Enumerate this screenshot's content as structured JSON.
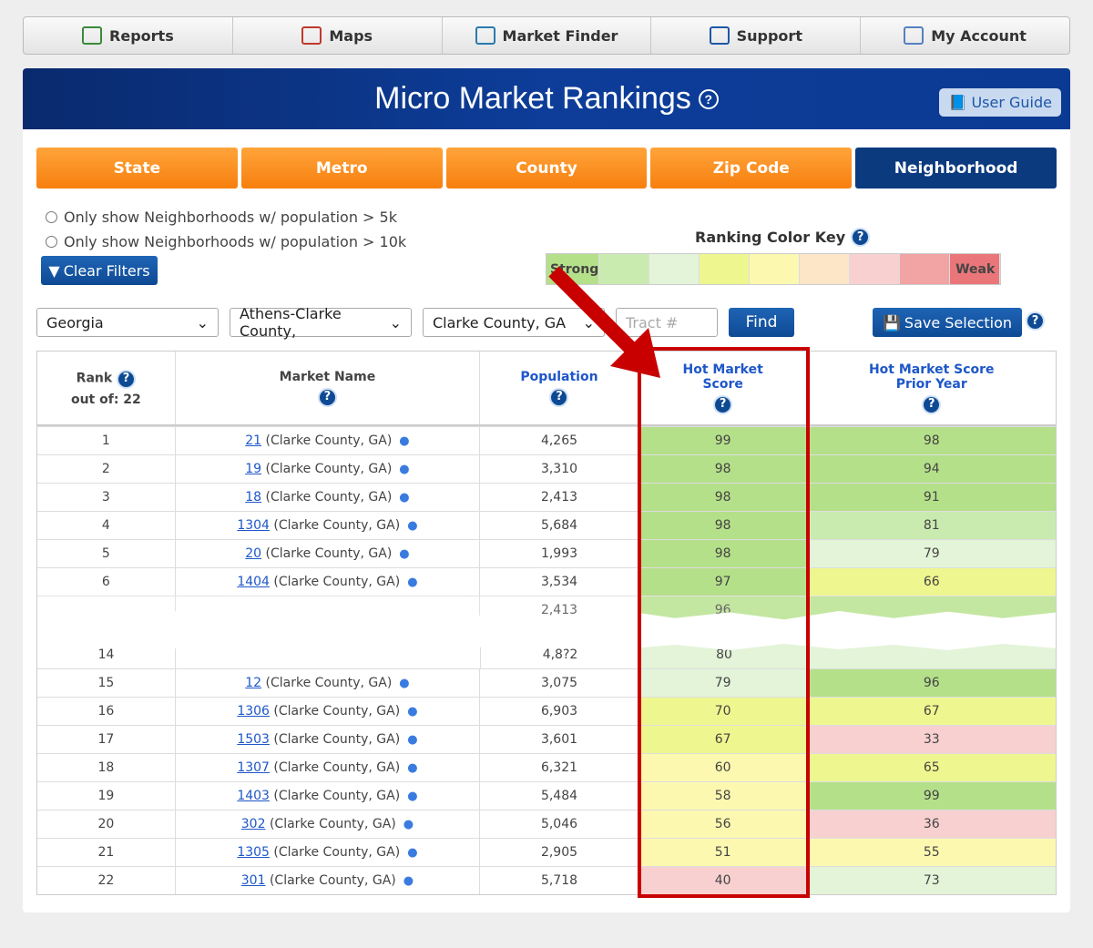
{
  "nav": [
    {
      "label": "Reports",
      "icon": "reports-icon"
    },
    {
      "label": "Maps",
      "icon": "maps-icon"
    },
    {
      "label": "Market Finder",
      "icon": "market-finder-icon"
    },
    {
      "label": "Support",
      "icon": "phone-icon"
    },
    {
      "label": "My Account",
      "icon": "account-icon"
    }
  ],
  "header": {
    "title": "Micro Market Rankings",
    "user_guide": "User Guide"
  },
  "tabs": [
    "State",
    "Metro",
    "County",
    "Zip Code",
    "Neighborhood"
  ],
  "active_tab": "Neighborhood",
  "filters": {
    "opt1": "Only show Neighborhoods w/ population > 5k",
    "opt2": "Only show Neighborhoods w/ population > 10k",
    "clear": "Clear Filters"
  },
  "color_key": {
    "title": "Ranking Color Key",
    "strong": "Strong",
    "weak": "Weak",
    "colors": [
      "#b5e08a",
      "#c9ebb0",
      "#e3f4d9",
      "#eef78f",
      "#fdf8b0",
      "#fde5c8",
      "#f8d0d0",
      "#f2a3a3",
      "#ea767a"
    ]
  },
  "selectors": {
    "state": "Georgia",
    "metro": "Athens-Clarke County,",
    "county": "Clarke County, GA",
    "tract_placeholder": "Tract #",
    "find": "Find",
    "save": "Save Selection"
  },
  "table": {
    "headers": {
      "rank": "Rank",
      "rank_sub": "out of: 22",
      "name": "Market Name",
      "population": "Population",
      "hot1": "Hot Market",
      "hot2": "Score",
      "prior1": "Hot Market Score",
      "prior2": "Prior Year"
    },
    "rows_top": [
      {
        "rank": "1",
        "tract": "21",
        "county": "(Clarke County, GA)",
        "pop": "4,265",
        "score": "99",
        "prior": "98"
      },
      {
        "rank": "2",
        "tract": "19",
        "county": "(Clarke County, GA)",
        "pop": "3,310",
        "score": "98",
        "prior": "94"
      },
      {
        "rank": "3",
        "tract": "18",
        "county": "(Clarke County, GA)",
        "pop": "2,413",
        "score": "98",
        "prior": "91"
      },
      {
        "rank": "4",
        "tract": "1304",
        "county": "(Clarke County, GA)",
        "pop": "5,684",
        "score": "98",
        "prior": "81"
      },
      {
        "rank": "5",
        "tract": "20",
        "county": "(Clarke County, GA)",
        "pop": "1,993",
        "score": "98",
        "prior": "79"
      },
      {
        "rank": "6",
        "tract": "1404",
        "county": "(Clarke County, GA)",
        "pop": "3,534",
        "score": "97",
        "prior": "66"
      }
    ],
    "torn": {
      "row7_pop": "2,413",
      "row7_score": "96",
      "row14_rank": "14",
      "row14_pop": "4,8?2",
      "row14_score": "80"
    },
    "rows_bottom": [
      {
        "rank": "15",
        "tract": "12",
        "county": "(Clarke County, GA)",
        "pop": "3,075",
        "score": "79",
        "prior": "96"
      },
      {
        "rank": "16",
        "tract": "1306",
        "county": "(Clarke County, GA)",
        "pop": "6,903",
        "score": "70",
        "prior": "67"
      },
      {
        "rank": "17",
        "tract": "1503",
        "county": "(Clarke County, GA)",
        "pop": "3,601",
        "score": "67",
        "prior": "33"
      },
      {
        "rank": "18",
        "tract": "1307",
        "county": "(Clarke County, GA)",
        "pop": "6,321",
        "score": "60",
        "prior": "65"
      },
      {
        "rank": "19",
        "tract": "1403",
        "county": "(Clarke County, GA)",
        "pop": "5,484",
        "score": "58",
        "prior": "99"
      },
      {
        "rank": "20",
        "tract": "302",
        "county": "(Clarke County, GA)",
        "pop": "5,046",
        "score": "56",
        "prior": "36"
      },
      {
        "rank": "21",
        "tract": "1305",
        "county": "(Clarke County, GA)",
        "pop": "2,905",
        "score": "51",
        "prior": "55"
      },
      {
        "rank": "22",
        "tract": "301",
        "county": "(Clarke County, GA)",
        "pop": "5,718",
        "score": "40",
        "prior": "73"
      }
    ]
  }
}
